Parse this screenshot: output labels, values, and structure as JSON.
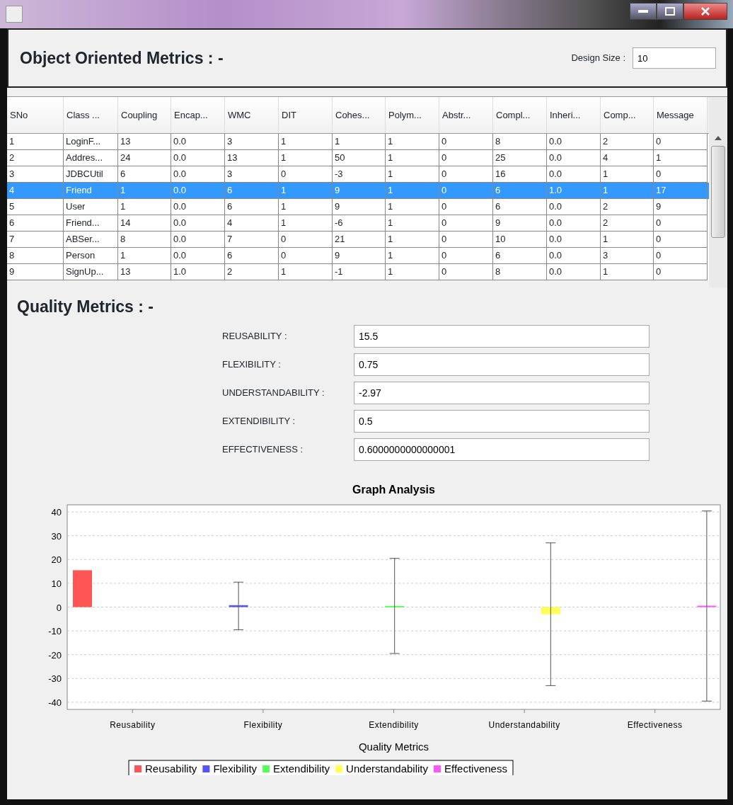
{
  "header": {
    "title": "Object Oriented Metrics : -",
    "design_size_label": "Design Size :",
    "design_size_value": "10"
  },
  "table": {
    "columns": [
      "SNo",
      "Class ...",
      "Coupling",
      "Encap...",
      "WMC",
      "DIT",
      "Cohes...",
      "Polym...",
      "Abstr...",
      "Compl...",
      "Inheri...",
      "Comp...",
      "Message"
    ],
    "rows": [
      {
        "selected": false,
        "cells": [
          "1",
          "LoginF...",
          "13",
          "0.0",
          "3",
          "1",
          "1",
          "1",
          "0",
          "8",
          "0.0",
          "2",
          "0"
        ]
      },
      {
        "selected": false,
        "cells": [
          "2",
          "Addres...",
          "24",
          "0.0",
          "13",
          "1",
          "50",
          "1",
          "0",
          "25",
          "0.0",
          "4",
          "1"
        ]
      },
      {
        "selected": false,
        "cells": [
          "3",
          "JDBCUtil",
          "6",
          "0.0",
          "3",
          "0",
          "-3",
          "1",
          "0",
          "16",
          "0.0",
          "1",
          "0"
        ]
      },
      {
        "selected": true,
        "cells": [
          "4",
          "Friend",
          "1",
          "0.0",
          "6",
          "1",
          "9",
          "1",
          "0",
          "6",
          "1.0",
          "1",
          "17"
        ]
      },
      {
        "selected": false,
        "cells": [
          "5",
          "User",
          "1",
          "0.0",
          "6",
          "1",
          "9",
          "1",
          "0",
          "6",
          "0.0",
          "2",
          "9"
        ]
      },
      {
        "selected": false,
        "cells": [
          "6",
          "Friend...",
          "14",
          "0.0",
          "4",
          "1",
          "-6",
          "1",
          "0",
          "9",
          "0.0",
          "2",
          "0"
        ]
      },
      {
        "selected": false,
        "cells": [
          "7",
          "ABSer...",
          "8",
          "0.0",
          "7",
          "0",
          "21",
          "1",
          "0",
          "10",
          "0.0",
          "1",
          "0"
        ]
      },
      {
        "selected": false,
        "cells": [
          "8",
          "Person",
          "1",
          "0.0",
          "6",
          "0",
          "9",
          "1",
          "0",
          "6",
          "0.0",
          "3",
          "0"
        ]
      },
      {
        "selected": false,
        "cells": [
          "9",
          "SignUp...",
          "13",
          "1.0",
          "2",
          "1",
          "-1",
          "1",
          "0",
          "8",
          "0.0",
          "1",
          "0"
        ]
      }
    ]
  },
  "quality": {
    "title": "Quality Metrics : -",
    "fields": [
      {
        "label": "REUSABILITY :",
        "value": "15.5"
      },
      {
        "label": "FLEXIBILITY :",
        "value": "0.75"
      },
      {
        "label": "UNDERSTANDABILITY :",
        "value": "-2.97"
      },
      {
        "label": "EXTENDIBILITY :",
        "value": "0.5"
      },
      {
        "label": "EFFECTIVENESS :",
        "value": "0.6000000000000001"
      }
    ]
  },
  "chart_data": {
    "type": "bar",
    "title": "Graph Analysis",
    "xlabel": "Quality Metrics",
    "categories": [
      "Reusability",
      "Flexibility",
      "Extendibility",
      "Understandability",
      "Effectiveness"
    ],
    "series": [
      {
        "name": "Reusability",
        "color": "#ff5555",
        "values": [
          15.5,
          null,
          null,
          null,
          null
        ]
      },
      {
        "name": "Flexibility",
        "color": "#5555ff",
        "values": [
          null,
          0.8,
          null,
          null,
          null
        ],
        "errors": [
          null,
          [
            -9.5,
            10.5
          ],
          null,
          null,
          null
        ]
      },
      {
        "name": "Extendibility",
        "color": "#55ff55",
        "values": [
          null,
          null,
          0.5,
          null,
          null
        ],
        "errors": [
          null,
          null,
          [
            -19.5,
            20.5
          ],
          null,
          null
        ]
      },
      {
        "name": "Understandability",
        "color": "#ffff55",
        "values": [
          null,
          null,
          null,
          -3.0,
          null
        ],
        "errors": [
          null,
          null,
          null,
          [
            -33,
            27
          ],
          null
        ]
      },
      {
        "name": "Effectiveness",
        "color": "#ff55ff",
        "values": [
          null,
          null,
          null,
          null,
          0.6
        ],
        "errors": [
          null,
          null,
          null,
          null,
          [
            -39.5,
            40.4
          ]
        ]
      }
    ],
    "ylim": [
      -43,
      43
    ],
    "yticks": [
      -40,
      -30,
      -20,
      -10,
      0,
      10,
      20,
      30,
      40
    ],
    "grid": true,
    "legend": true
  }
}
